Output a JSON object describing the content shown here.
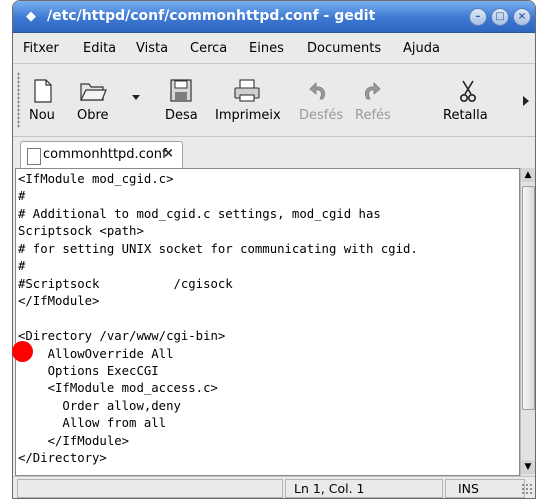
{
  "window": {
    "title": "/etc/httpd/conf/commonhttpd.conf - gedit"
  },
  "menubar": [
    "Fitxer",
    "Edita",
    "Vista",
    "Cerca",
    "Eines",
    "Documents",
    "Ajuda"
  ],
  "toolbar": {
    "new_label": "Nou",
    "open_label": "Obre",
    "save_label": "Desa",
    "print_label": "Imprimeix",
    "undo_label": "Desfés",
    "redo_label": "Refés",
    "cut_label": "Retalla"
  },
  "tab": {
    "label": "commonhttpd.conf",
    "close": "×"
  },
  "editor": {
    "content": "<IfModule mod_cgid.c>\n#\n# Additional to mod_cgid.c settings, mod_cgid has\nScriptsock <path>\n# for setting UNIX socket for communicating with cgid.\n#\n#Scriptsock          /cgisock\n</IfModule>\n\n<Directory /var/www/cgi-bin>\n    AllowOverride All\n    Options ExecCGI\n    <IfModule mod_access.c>\n      Order allow,deny\n      Allow from all\n    </IfModule>\n</Directory>"
  },
  "status": {
    "position": "Ln 1, Col. 1",
    "mode": "INS"
  }
}
